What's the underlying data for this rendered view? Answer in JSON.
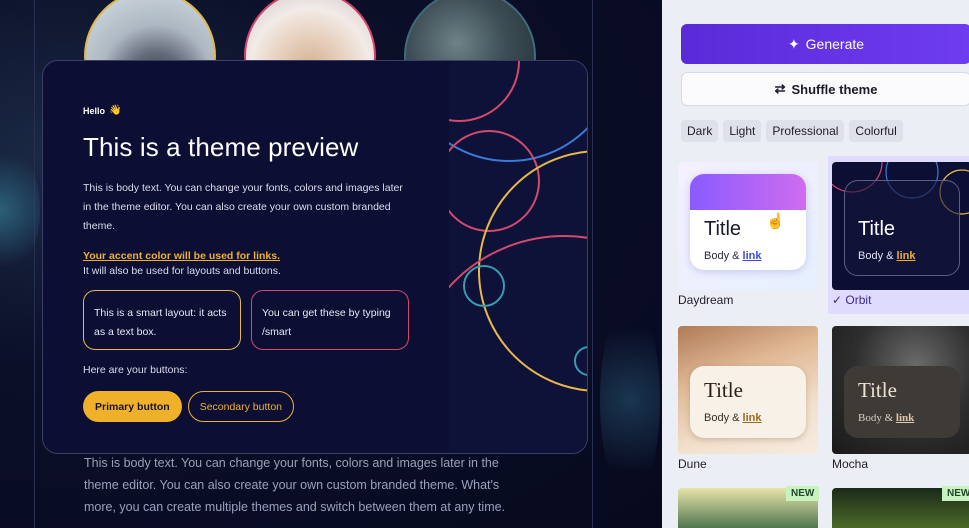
{
  "preview": {
    "hello": "Hello",
    "hello_emoji": "👋",
    "title": "This is a theme preview",
    "body": "This is body text. You can change your fonts, colors and images later in the theme editor. You can also create your own custom branded theme.",
    "accent_link": "Your accent color will be used for links.",
    "layout_note": "It will also be used for layouts and buttons.",
    "smart_box_1": "This is a smart layout: it acts as a text box.",
    "smart_box_2": "You can get these by typing /smart",
    "buttons_label": "Here are your buttons:",
    "primary_button": "Primary button",
    "secondary_button": "Secondary button",
    "below_text": "This is body text. You can change your fonts, colors and images later in the theme editor. You can also create your own custom branded theme. What's more, you can create multiple themes and switch between them at any time."
  },
  "panel": {
    "generate_label": "Generate",
    "shuffle_label": "Shuffle theme",
    "filters": [
      "Dark",
      "Light",
      "Professional",
      "Colorful"
    ],
    "themes": [
      {
        "name": "Daydream",
        "title": "Title",
        "body": "Body & ",
        "link": "link",
        "selected": false
      },
      {
        "name": "Orbit",
        "title": "Title",
        "body": "Body & ",
        "link": "link",
        "selected": true,
        "check": "✓"
      },
      {
        "name": "Dune",
        "title": "Title",
        "body": "Body & ",
        "link": "link",
        "selected": false
      },
      {
        "name": "Mocha",
        "title": "Title",
        "body": "Body & ",
        "link": "link",
        "selected": false
      }
    ],
    "new_badge": "NEW"
  },
  "colors": {
    "accent": "#f0b12a",
    "pink": "#d24a6c",
    "generate": "#5a2ad8",
    "selected_bg": "#dedbff"
  }
}
